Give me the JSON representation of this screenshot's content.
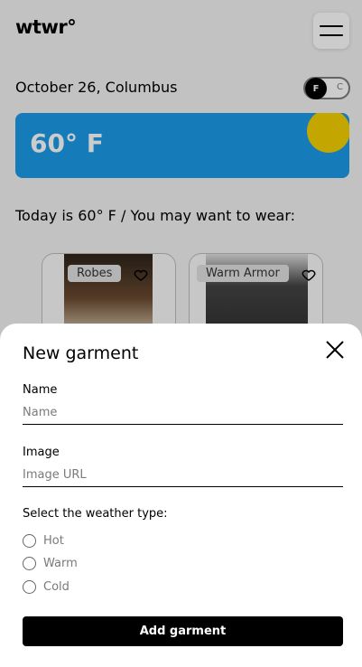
{
  "header": {
    "logo_text": "wtwr°",
    "menu_icon": "hamburger-icon"
  },
  "location_bar": {
    "date_location": "October 26, Columbus",
    "unit_toggle": {
      "active": "F",
      "inactive": "C"
    }
  },
  "weather_card": {
    "temperature": "60° F",
    "sun_color": "#f5d000",
    "sky_color": "#1b9be8"
  },
  "recommendation": {
    "text": "Today is 60° F / You may want to wear:"
  },
  "cards": [
    {
      "name": "Robes",
      "icon": "heart-outline-icon"
    },
    {
      "name": "Warm Armor",
      "icon": "heart-outline-icon"
    }
  ],
  "modal": {
    "title": "New garment",
    "close_icon": "close-icon",
    "name_field": {
      "label": "Name",
      "placeholder": "Name"
    },
    "image_field": {
      "label": "Image",
      "placeholder": "Image URL"
    },
    "weather_select": {
      "title": "Select the weather type:",
      "options": [
        "Hot",
        "Warm",
        "Cold"
      ]
    },
    "submit_label": "Add garment"
  }
}
